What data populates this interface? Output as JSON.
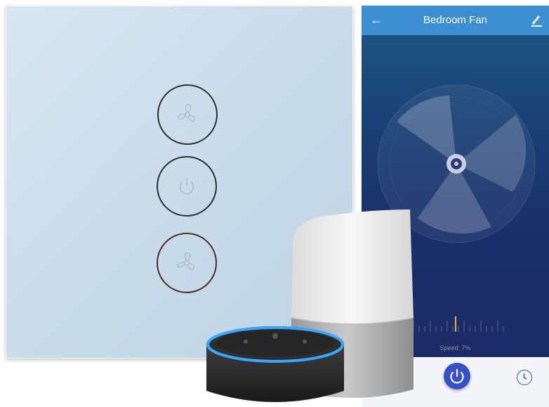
{
  "app": {
    "title": "Bedroom Fan",
    "back_icon": "arrow-left-icon",
    "edit_icon": "pencil-icon",
    "speed_label": "Speed: 7%",
    "speed_percent": 7,
    "power_icon": "power-icon",
    "timer_icon": "clock-icon"
  },
  "panel": {
    "buttons": [
      "fan-icon",
      "power-icon",
      "fan-icon"
    ]
  },
  "colors": {
    "panel": "#c8dbe9",
    "app_bar": "#3d8fd4",
    "app_background": "#1a2e6a",
    "accent": "#3550c8",
    "speaker_ring": "#35a8ff"
  }
}
